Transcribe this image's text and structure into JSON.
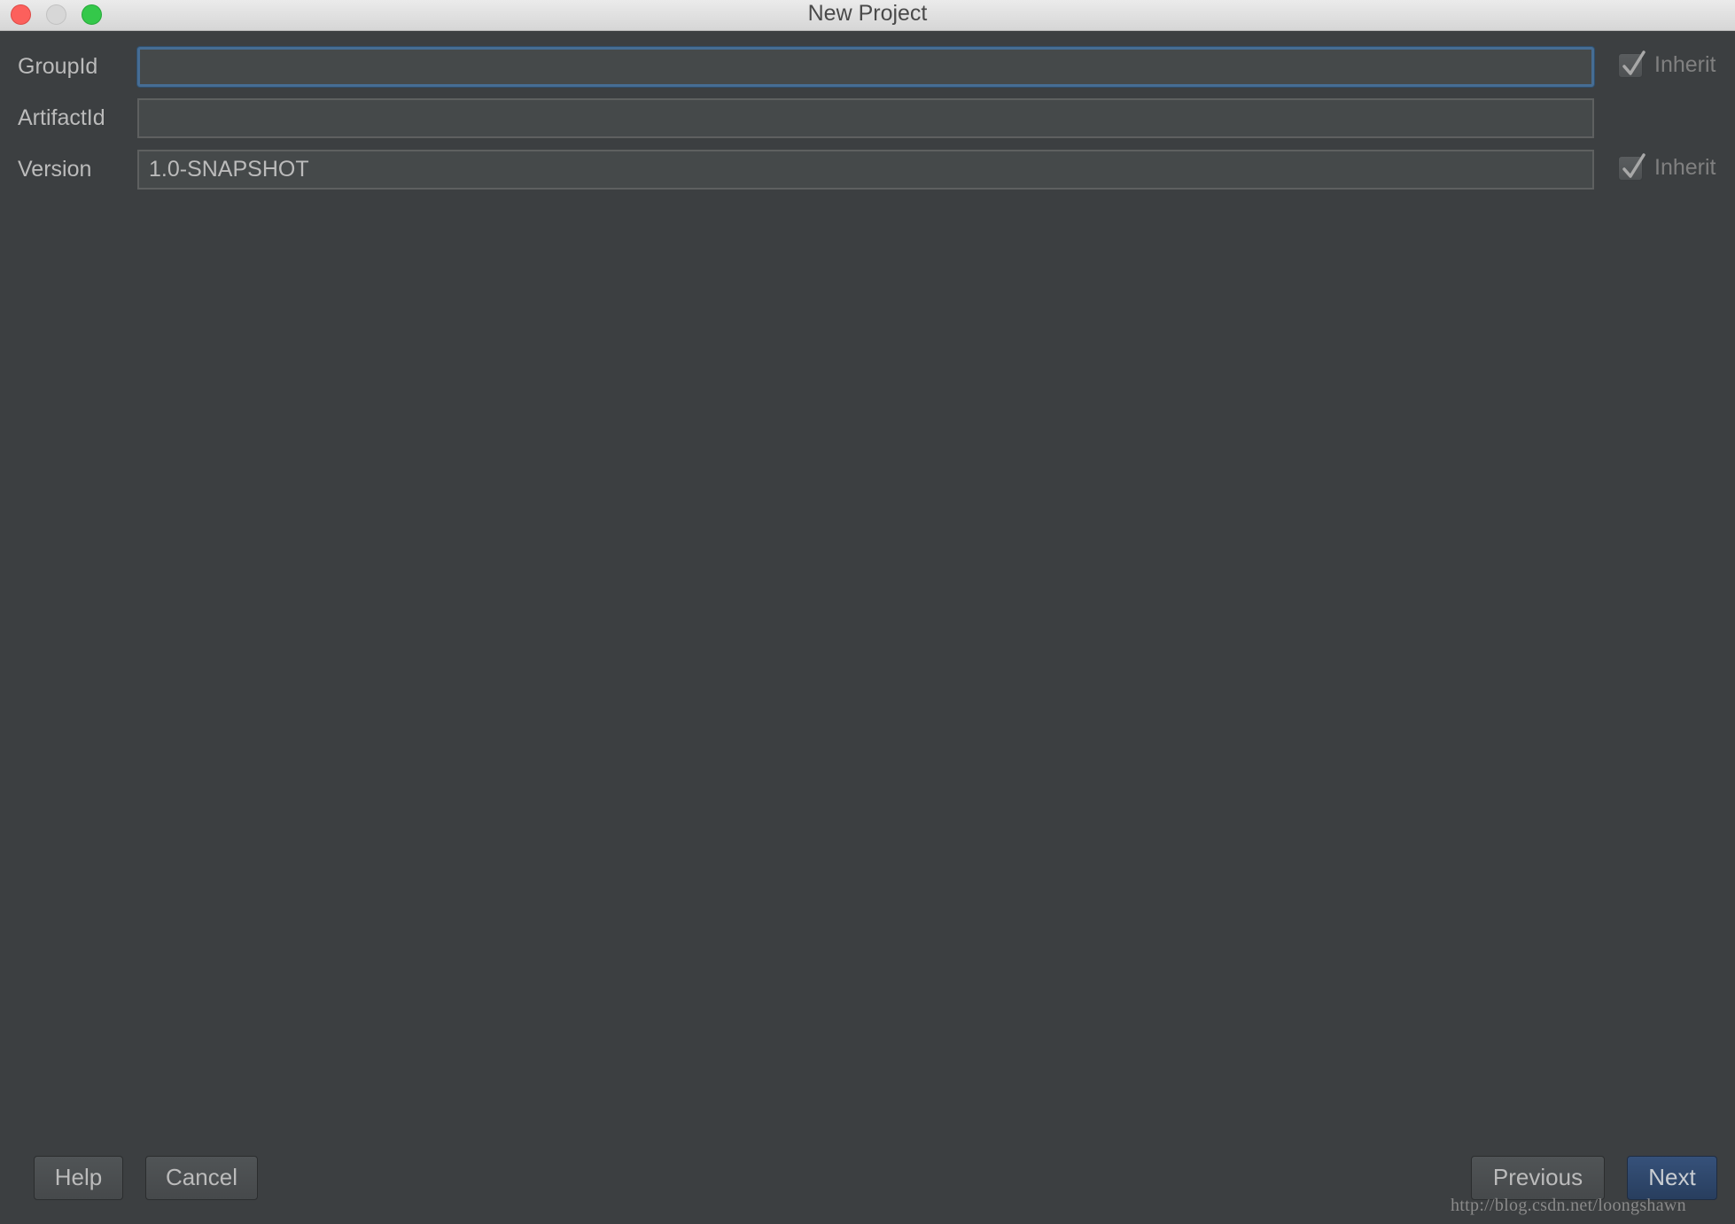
{
  "window": {
    "title": "New Project",
    "controls": [
      "close",
      "minimize",
      "maximize"
    ]
  },
  "form": {
    "group_id": {
      "label": "GroupId",
      "value": "",
      "focused": true,
      "inherit": {
        "label": "Inherit",
        "checked": true
      }
    },
    "artifact_id": {
      "label": "ArtifactId",
      "value": ""
    },
    "version": {
      "label": "Version",
      "value": "1.0-SNAPSHOT",
      "inherit": {
        "label": "Inherit",
        "checked": true
      }
    }
  },
  "buttons": {
    "help": "Help",
    "cancel": "Cancel",
    "previous": "Previous",
    "next": "Next"
  },
  "watermark": "http://blog.csdn.net/loongshawn",
  "colors": {
    "background": "#3c3f41",
    "focus_border": "#466d94",
    "primary_button": "#2f4768"
  }
}
